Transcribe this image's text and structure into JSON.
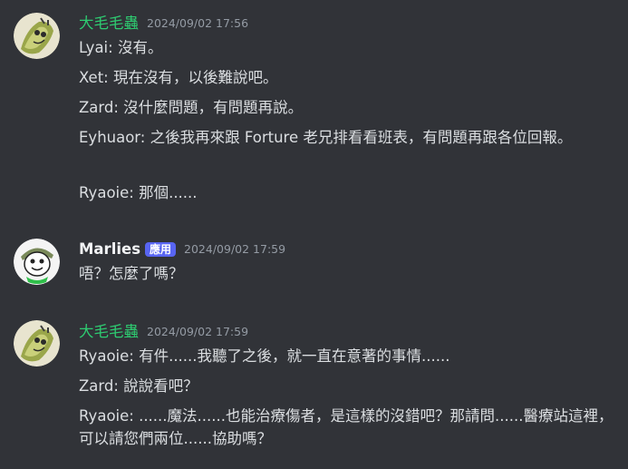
{
  "messages": [
    {
      "username": "大毛毛蟲",
      "timestamp": "2024/09/02 17:56",
      "lines": [
        "Lyai: 沒有。",
        "Xet: 現在沒有，以後難說吧。",
        "Zard: 沒什麼問題，有問題再說。",
        "Eyhuaor: 之後我再來跟 Forture 老兄排看看班表，有問題再跟各位回報。",
        "Ryaoie: 那個......"
      ]
    },
    {
      "username": "Marlies",
      "badge": "應用",
      "timestamp": "2024/09/02 17:59",
      "lines": [
        "唔？怎麼了嗎？"
      ]
    },
    {
      "username": "大毛毛蟲",
      "timestamp": "2024/09/02 17:59",
      "lines": [
        "Ryaoie: 有件......我聽了之後，就一直在意著的事情......",
        "Zard: 說說看吧？",
        "Ryaoie: ......魔法......也能治療傷者，是這樣的沒錯吧？那請問......醫療站這裡，可以請您們兩位......協助嗎？"
      ]
    }
  ],
  "colors": {
    "background": "#313338",
    "username_green": "#2ecc71",
    "badge_bg": "#5865f2",
    "timestamp": "#949ba4",
    "text": "#dbdee1"
  },
  "icons": {
    "avatar1": "caterpillar-avatar-icon",
    "avatar2": "marlies-avatar-icon",
    "avatar3": "caterpillar-avatar-icon"
  }
}
